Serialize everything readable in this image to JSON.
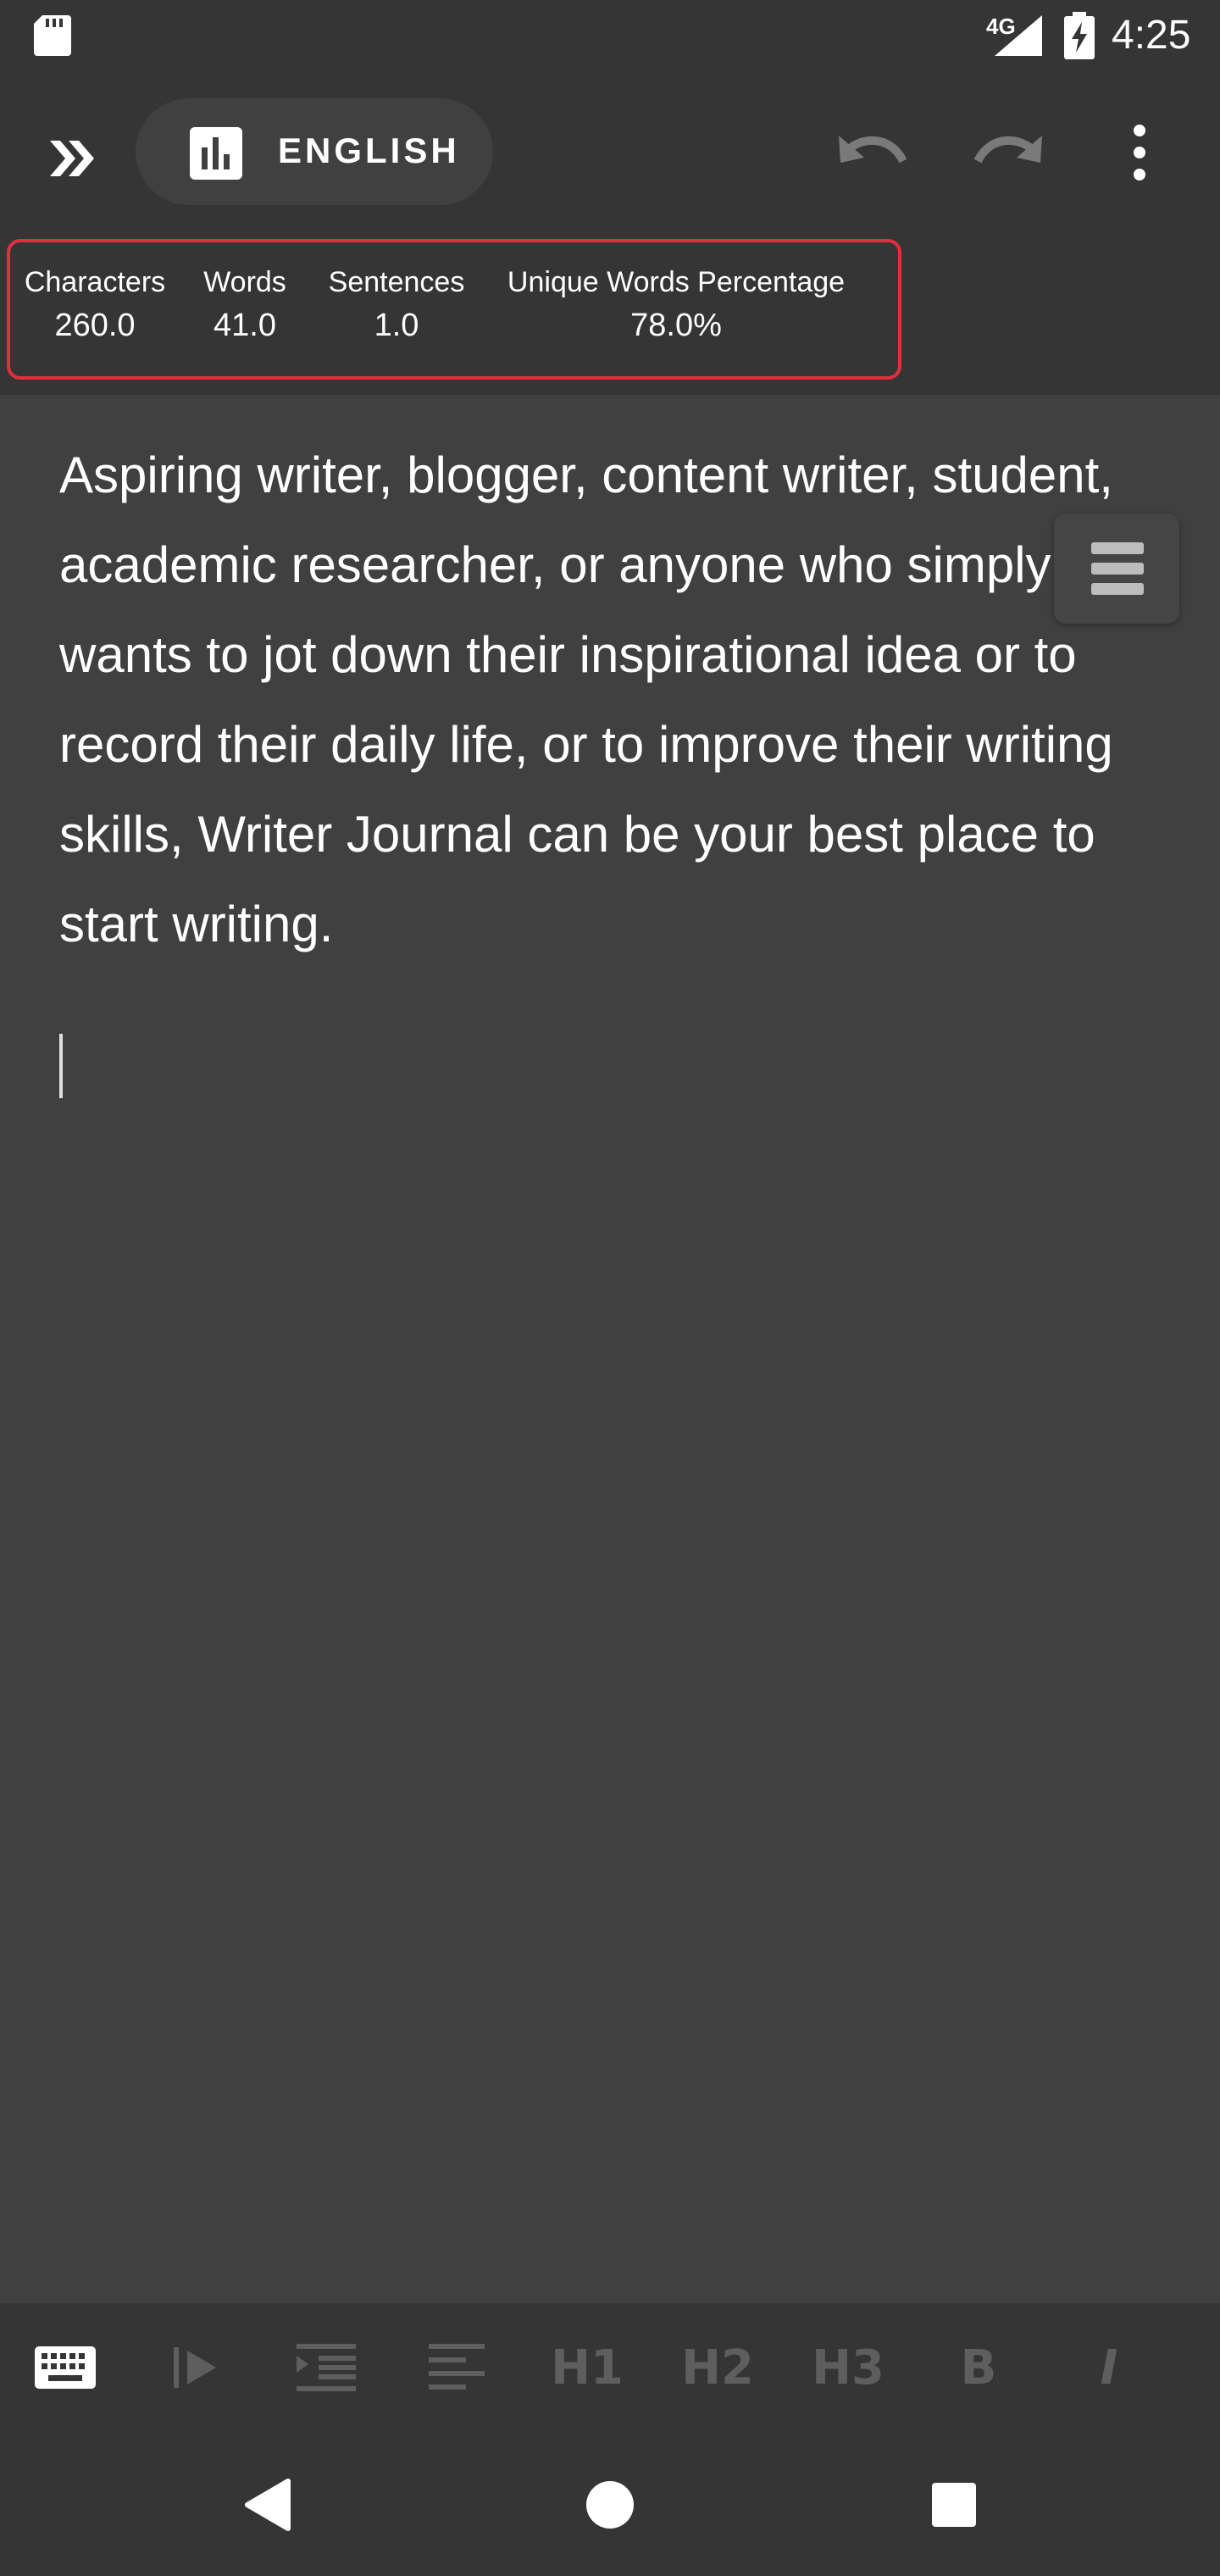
{
  "status_bar": {
    "network": "4G",
    "time": "4:25"
  },
  "toolbar": {
    "language": "ENGLISH"
  },
  "stats": {
    "characters": {
      "label": "Characters",
      "value": "260.0"
    },
    "words": {
      "label": "Words",
      "value": "41.0"
    },
    "sentences": {
      "label": "Sentences",
      "value": "1.0"
    },
    "unique_words": {
      "label": "Unique Words Percentage",
      "value": "78.0%"
    }
  },
  "editor": {
    "text": "Aspiring writer, blogger, content writer, student, academic researcher, or anyone who simply wants to jot down their inspirational idea or to record their daily life, or to improve their writing skills, Writer Journal can be your best place to start writing."
  },
  "format_toolbar": {
    "h1": "H1",
    "h2": "H2",
    "h3": "H3",
    "bold": "B",
    "italic": "I"
  },
  "colors": {
    "background": "#404040",
    "bars": "#353535",
    "highlight_border": "#e0303e",
    "inactive_icon": "#5e5e5e"
  },
  "icons": [
    "sd-card-icon",
    "signal-icon",
    "battery-charging-icon",
    "double-chevron-right-icon",
    "bar-chart-icon",
    "undo-icon",
    "redo-icon",
    "more-vert-icon",
    "outline-menu-icon",
    "keyboard-icon",
    "play-indent-icon",
    "indent-icon",
    "align-left-icon",
    "back-icon",
    "home-icon",
    "recents-icon"
  ]
}
